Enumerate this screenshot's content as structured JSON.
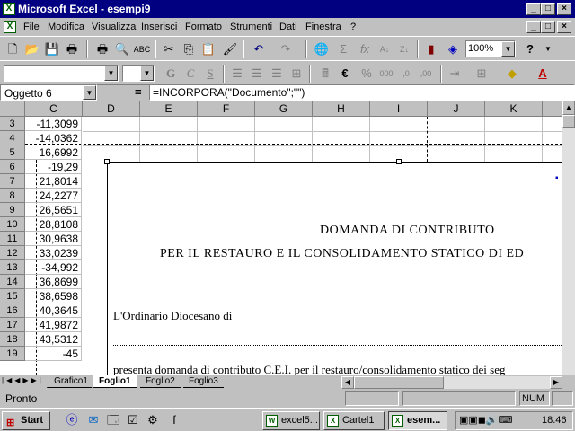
{
  "window": {
    "title": "Microsoft Excel - esempi9"
  },
  "menu": [
    "File",
    "Modifica",
    "Visualizza",
    "Inserisci",
    "Formato",
    "Strumenti",
    "Dati",
    "Finestra",
    "?"
  ],
  "toolbar": {
    "zoom": "100%"
  },
  "formula_bar": {
    "name_box": "Oggetto 6",
    "equals": "=",
    "formula": "=INCORPORA(\"Documento\";\"\")"
  },
  "columns": [
    "C",
    "D",
    "E",
    "F",
    "G",
    "H",
    "I",
    "J",
    "K"
  ],
  "rows": [
    {
      "num": "3",
      "c": "-11,3099"
    },
    {
      "num": "4",
      "c": "-14,0362"
    },
    {
      "num": "5",
      "c": "16,6992"
    },
    {
      "num": "6",
      "c": "-19,29"
    },
    {
      "num": "7",
      "c": "21,8014"
    },
    {
      "num": "8",
      "c": "24,2277"
    },
    {
      "num": "9",
      "c": "26,5651"
    },
    {
      "num": "10",
      "c": "28,8108"
    },
    {
      "num": "11",
      "c": "30,9638"
    },
    {
      "num": "12",
      "c": "33,0239"
    },
    {
      "num": "13",
      "c": "-34,992"
    },
    {
      "num": "14",
      "c": "36,8699"
    },
    {
      "num": "15",
      "c": "38,6598"
    },
    {
      "num": "16",
      "c": "40,3645"
    },
    {
      "num": "17",
      "c": "41,9872"
    },
    {
      "num": "18",
      "c": "43,5312"
    },
    {
      "num": "19",
      "c": "-45"
    }
  ],
  "document": {
    "title_line1": "DOMANDA DI CONTRIBUTO",
    "title_line2": "PER IL RESTAURO E IL CONSOLIDAMENTO STATICO DI ED",
    "ordinario": "L'Ordinario Diocesano di",
    "presenta": "presenta domanda di contributo C.E.I. per il restauro/consolidamento statico dei seg"
  },
  "sheet_tabs": [
    "Grafico1",
    "Foglio1",
    "Foglio2",
    "Foglio3"
  ],
  "active_sheet": "Foglio1",
  "status": {
    "text": "Pronto",
    "num": "NUM"
  },
  "taskbar": {
    "start": "Start",
    "tasks": [
      "excel5...",
      "Cartel1",
      "esem..."
    ],
    "clock": "18.46"
  }
}
